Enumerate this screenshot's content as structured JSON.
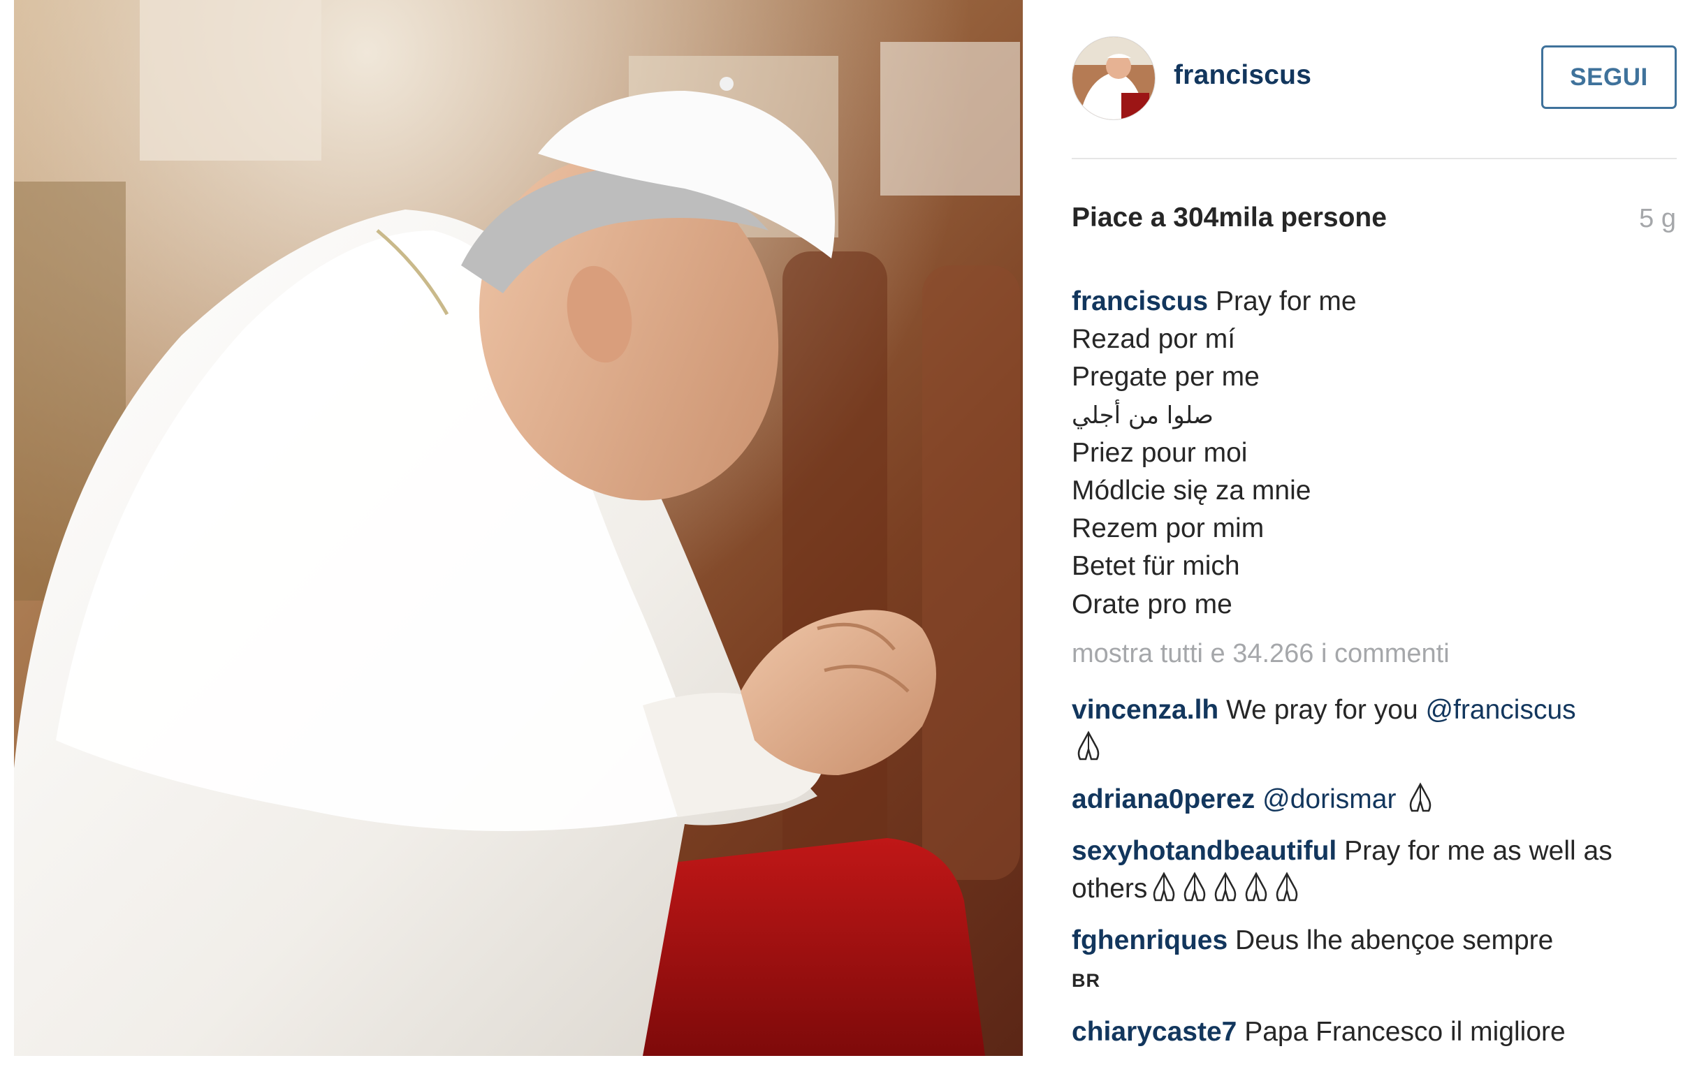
{
  "post": {
    "username": "franciscus",
    "follow_label": "SEGUI",
    "likes_text": "Piace a 304mila persone",
    "age": "5 g",
    "caption_lines": [
      "Pray for me",
      "Rezad por mí",
      "Pregate per me",
      "صلوا من أجلي",
      "Priez pour moi",
      "Módlcie się za mnie",
      "Rezem por mim",
      "Betet für mich",
      "Orate pro me"
    ],
    "view_all_comments": "mostra tutti e 34.266 i commenti"
  },
  "comments": [
    {
      "user": "vincenza.lh",
      "text": "We pray for you ",
      "mention": "@franciscus",
      "icons_after": 1
    },
    {
      "user": "adriana0perez",
      "text": "",
      "mention": "@dorismar",
      "icons_after": 1
    },
    {
      "user": "sexyhotandbeautiful",
      "text": "Pray for me as well as others",
      "mention": "",
      "icons_after": 5
    },
    {
      "user": "fghenriques",
      "text": "Deus lhe abençoe sempre",
      "extra": "BR"
    },
    {
      "user": "chiarycaste7",
      "text": "Papa Francesco il migliore"
    }
  ],
  "icons": {
    "pray": "folded-hands-icon",
    "avatar": "profile-photo"
  },
  "colors": {
    "username": "#12365d",
    "follow_border": "#3f729b",
    "muted": "#a5a7aa",
    "text": "#262626"
  }
}
